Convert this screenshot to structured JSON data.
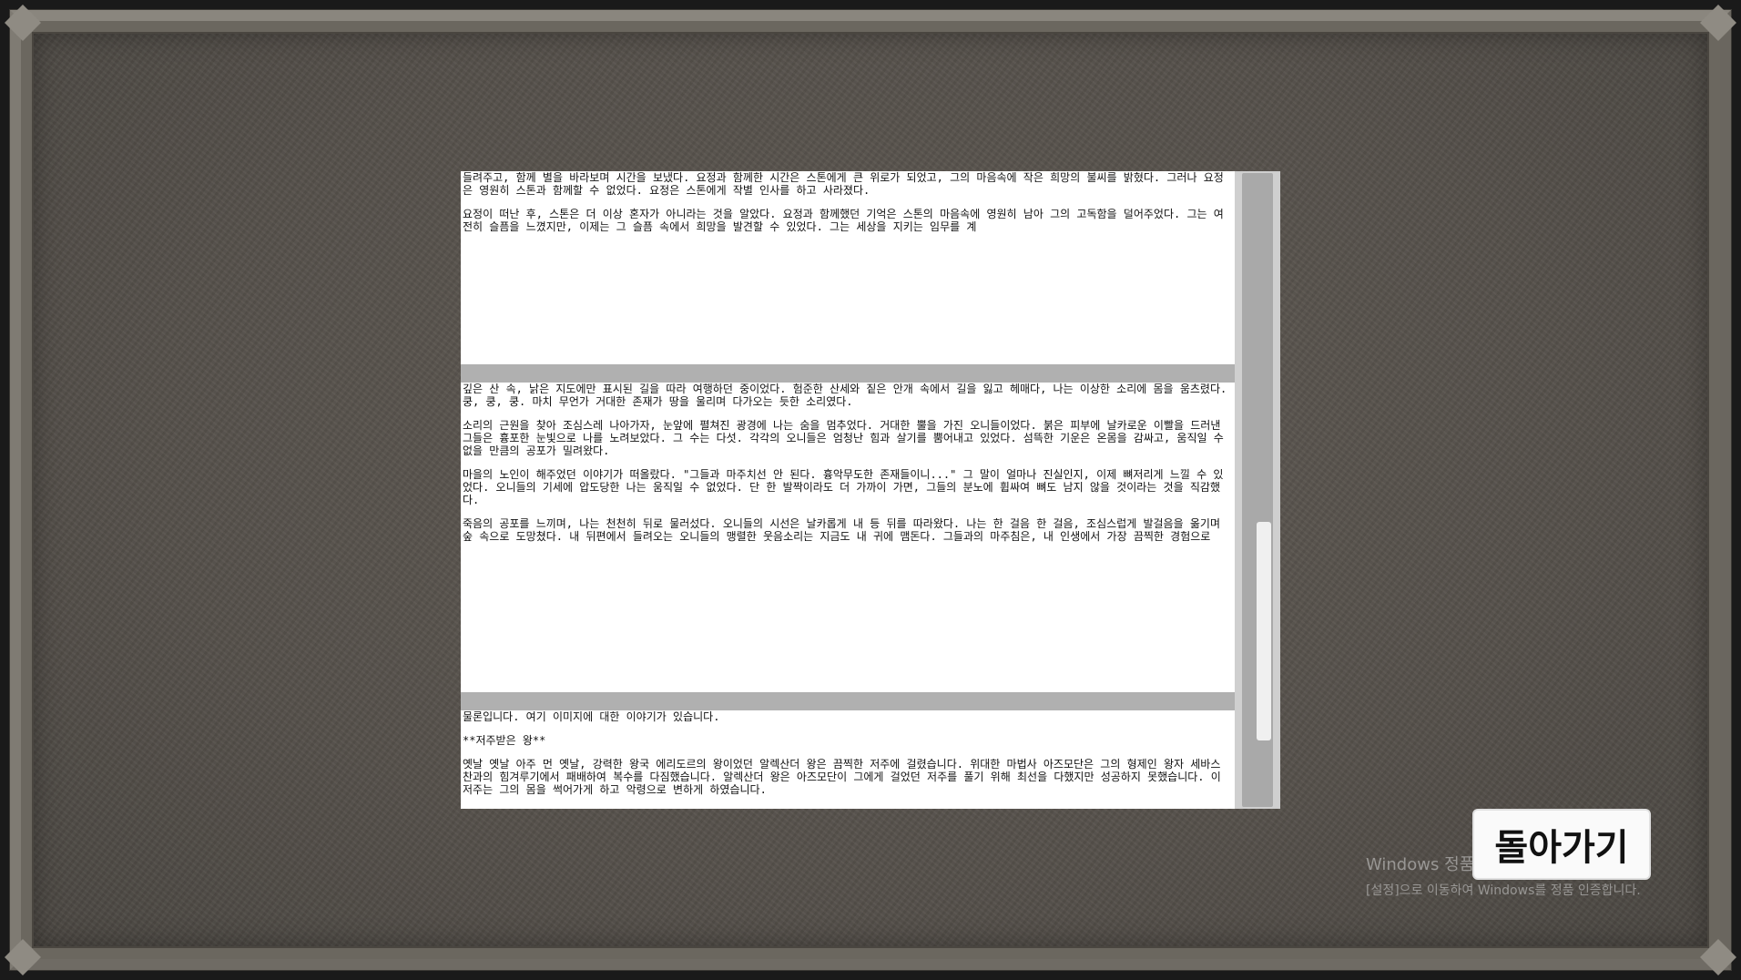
{
  "viewer": {
    "pages": [
      {
        "paragraphs": [
          "들려주고, 함께 별을 바라보며 시간을 보냈다. 요정과 함께한 시간은 스톤에게 큰 위로가 되었고, 그의 마음속에 작은 희망의 불씨를 밝혔다. 그러나 요정은 영원히 스톤과 함께할 수 없었다. 요정은 스톤에게 작별 인사를 하고 사라졌다.",
          "요정이 떠난 후, 스톤은 더 이상 혼자가 아니라는 것을 알았다. 요정과 함께했던 기억은 스톤의 마음속에 영원히 남아 그의 고독함을 덜어주었다. 그는 여전히 슬픔을 느꼈지만, 이제는 그 슬픔 속에서 희망을 발견할 수 있었다. 그는 세상을 지키는 임무를 계"
        ]
      },
      {
        "paragraphs": [
          "깊은 산 속, 낡은 지도에만 표시된 길을 따라 여행하던 중이었다. 험준한 산세와 짙은 안개 속에서 길을 잃고 헤매다, 나는 이상한 소리에 몸을 움츠렸다. 쿵, 쿵, 쿵. 마치 무언가 거대한 존재가 땅을 울리며 다가오는 듯한 소리였다.",
          "소리의 근원을 찾아 조심스레 나아가자, 눈앞에 펼쳐진 광경에 나는 숨을 멈추었다. 거대한 뿔을 가진 오니들이었다. 붉은 피부에 날카로운 이빨을 드러낸 그들은 흉포한 눈빛으로 나를 노려보았다. 그 수는 다섯. 각각의 오니들은 엄청난 힘과 살기를 뿜어내고 있었다. 섬뜩한 기운은 온몸을 감싸고, 움직일 수 없을 만큼의 공포가 밀려왔다.",
          "마을의 노인이 해주었던 이야기가 떠올랐다. \"그들과 마주치선 안 된다. 흉악무도한 존재들이니...\" 그 말이 얼마나 진실인지, 이제 뼈저리게 느낄 수 있었다. 오니들의 기세에 압도당한 나는 움직일 수 없었다. 단 한 발짝이라도 더 가까이 가면, 그들의 분노에 휩싸여 뼈도 남지 않을 것이라는 것을 직감했다.",
          "죽음의 공포를 느끼며, 나는 천천히 뒤로 물러섰다. 오니들의 시선은 날카롭게 내 등 뒤를 따라왔다. 나는 한 걸음 한 걸음, 조심스럽게 발걸음을 옮기며 숲 속으로 도망쳤다. 내 뒤편에서 들려오는 오니들의 맹렬한 웃음소리는 지금도 내 귀에 맴돈다. 그들과의 마주침은, 내 인생에서 가장 끔찍한 경험으로"
        ]
      },
      {
        "paragraphs": [
          "물론입니다. 여기 이미지에 대한 이야기가 있습니다.",
          "**저주받은 왕**",
          "옛날 옛날 아주 먼 옛날, 강력한 왕국 에리도르의 왕이었던 알렉산더 왕은 끔찍한 저주에 걸렸습니다. 위대한 마법사 아즈모단은 그의 형제인 왕자 세바스찬과의 힘겨루기에서 패배하여 복수를 다짐했습니다. 알렉산더 왕은 아즈모단이 그에게 걸었던 저주를 풀기 위해 최선을 다했지만 성공하지 못했습니다. 이 저주는 그의 몸을 썩어가게 하고 악령으로 변하게 하였습니다."
        ]
      }
    ]
  },
  "back_button": {
    "label": "돌아가기"
  },
  "watermark": {
    "line1": "Windows 정품 인증",
    "line2": "[설정]으로 이동하여 Windows를 정품 인증합니다."
  }
}
